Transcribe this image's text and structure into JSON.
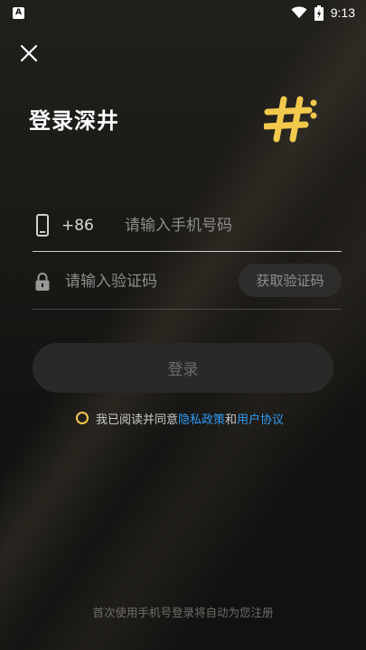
{
  "status_bar": {
    "time": "9:13",
    "app_indicator": "A"
  },
  "title": "登录深井",
  "phone": {
    "country_code": "+86",
    "placeholder": "请输入手机号码"
  },
  "code": {
    "placeholder": "请输入验证码",
    "get_code_label": "获取验证码"
  },
  "login_label": "登录",
  "agreement": {
    "prefix": "我已阅读并同意",
    "privacy_link": "隐私政策",
    "connector": "和",
    "user_link": "用户协议"
  },
  "footer_note": "首次使用手机号登录将自动为您注册",
  "colors": {
    "accent_yellow": "#f2c94c",
    "link_blue": "#2f9bf2"
  }
}
